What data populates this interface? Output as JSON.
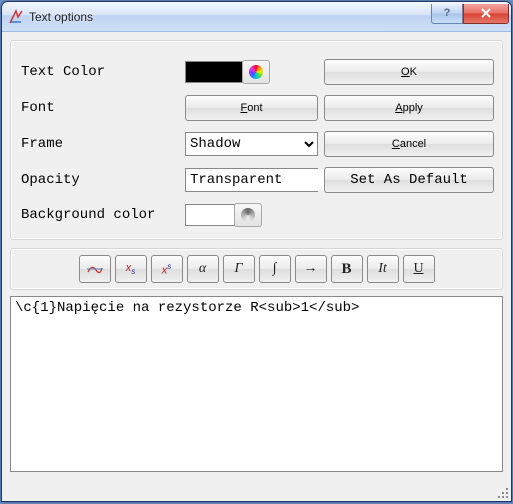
{
  "title": "Text options",
  "labels": {
    "text_color": "Text Color",
    "font": "Font",
    "frame": "Frame",
    "opacity": "Opacity",
    "bgcolor": "Background color"
  },
  "controls": {
    "font_button": "Font",
    "frame_value": "Shadow",
    "opacity_value": "Transparent"
  },
  "buttons": {
    "ok": "OK",
    "apply": "Apply",
    "cancel": "Cancel",
    "default": "Set As Default"
  },
  "toolbar": {
    "alpha": "α",
    "gamma": "Γ",
    "integral": "∫",
    "arrow": "→",
    "bold": "B",
    "italic": "It",
    "underline": "U"
  },
  "editor": {
    "value": "\\c{1}Napięcie na rezystorze R<sub>1</sub>"
  },
  "colors": {
    "text_color_value": "#000000",
    "bg_color_value": "#ffffff"
  }
}
